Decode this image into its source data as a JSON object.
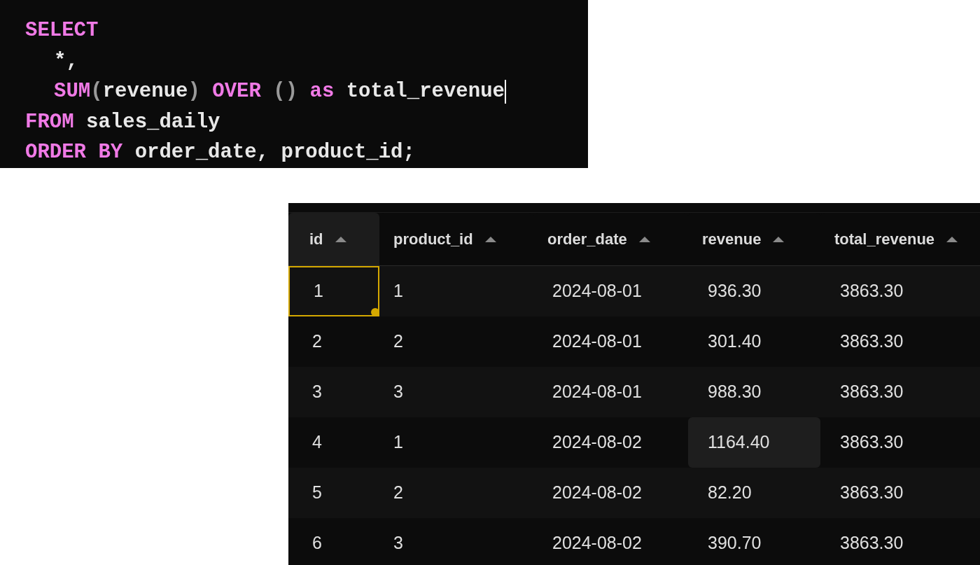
{
  "editor": {
    "lines": [
      {
        "indent": false,
        "cursor": false,
        "tokens": [
          {
            "kind": "keyword",
            "text": "SELECT"
          }
        ]
      },
      {
        "indent": true,
        "cursor": false,
        "tokens": [
          {
            "kind": "text",
            "text": "*,"
          }
        ]
      },
      {
        "indent": true,
        "cursor": true,
        "tokens": [
          {
            "kind": "keyword",
            "text": "SUM"
          },
          {
            "kind": "punct",
            "text": "("
          },
          {
            "kind": "text",
            "text": "revenue"
          },
          {
            "kind": "punct",
            "text": ")"
          },
          {
            "kind": "keyword",
            "text": " OVER "
          },
          {
            "kind": "punct",
            "text": "()"
          },
          {
            "kind": "keyword",
            "text": " as "
          },
          {
            "kind": "text",
            "text": "total_revenue"
          }
        ]
      },
      {
        "indent": false,
        "cursor": false,
        "tokens": [
          {
            "kind": "keyword",
            "text": "FROM "
          },
          {
            "kind": "text",
            "text": "sales_daily"
          }
        ]
      },
      {
        "indent": false,
        "cursor": false,
        "tokens": [
          {
            "kind": "keyword",
            "text": "ORDER BY "
          },
          {
            "kind": "text",
            "text": "order_date, product_id;"
          }
        ]
      }
    ]
  },
  "table": {
    "columns": [
      {
        "label": "id",
        "hovered": true
      },
      {
        "label": "product_id",
        "hovered": false
      },
      {
        "label": "order_date",
        "hovered": false
      },
      {
        "label": "revenue",
        "hovered": false
      },
      {
        "label": "total_revenue",
        "hovered": false
      }
    ],
    "rows": [
      {
        "cells": [
          {
            "text": "1",
            "selected": true,
            "hovered": false
          },
          {
            "text": "1",
            "selected": false,
            "hovered": false
          },
          {
            "text": "2024-08-01",
            "selected": false,
            "hovered": false
          },
          {
            "text": "936.30",
            "selected": false,
            "hovered": false
          },
          {
            "text": "3863.30",
            "selected": false,
            "hovered": false
          }
        ]
      },
      {
        "cells": [
          {
            "text": "2",
            "selected": false,
            "hovered": false
          },
          {
            "text": "2",
            "selected": false,
            "hovered": false
          },
          {
            "text": "2024-08-01",
            "selected": false,
            "hovered": false
          },
          {
            "text": "301.40",
            "selected": false,
            "hovered": false
          },
          {
            "text": "3863.30",
            "selected": false,
            "hovered": false
          }
        ]
      },
      {
        "cells": [
          {
            "text": "3",
            "selected": false,
            "hovered": false
          },
          {
            "text": "3",
            "selected": false,
            "hovered": false
          },
          {
            "text": "2024-08-01",
            "selected": false,
            "hovered": false
          },
          {
            "text": "988.30",
            "selected": false,
            "hovered": false
          },
          {
            "text": "3863.30",
            "selected": false,
            "hovered": false
          }
        ]
      },
      {
        "cells": [
          {
            "text": "4",
            "selected": false,
            "hovered": false
          },
          {
            "text": "1",
            "selected": false,
            "hovered": false
          },
          {
            "text": "2024-08-02",
            "selected": false,
            "hovered": false
          },
          {
            "text": "1164.40",
            "selected": false,
            "hovered": true
          },
          {
            "text": "3863.30",
            "selected": false,
            "hovered": false
          }
        ]
      },
      {
        "cells": [
          {
            "text": "5",
            "selected": false,
            "hovered": false
          },
          {
            "text": "2",
            "selected": false,
            "hovered": false
          },
          {
            "text": "2024-08-02",
            "selected": false,
            "hovered": false
          },
          {
            "text": "82.20",
            "selected": false,
            "hovered": false
          },
          {
            "text": "3863.30",
            "selected": false,
            "hovered": false
          }
        ]
      },
      {
        "cells": [
          {
            "text": "6",
            "selected": false,
            "hovered": false
          },
          {
            "text": "3",
            "selected": false,
            "hovered": false
          },
          {
            "text": "2024-08-02",
            "selected": false,
            "hovered": false
          },
          {
            "text": "390.70",
            "selected": false,
            "hovered": false
          },
          {
            "text": "3863.30",
            "selected": false,
            "hovered": false
          }
        ]
      }
    ]
  }
}
